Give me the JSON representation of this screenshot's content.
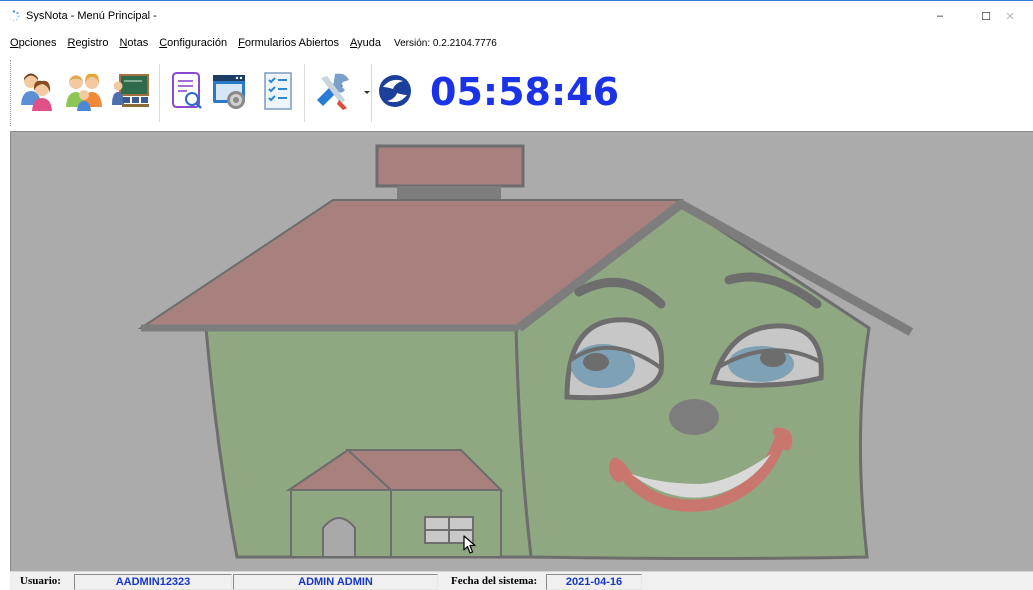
{
  "window": {
    "title": "SysNota - Menú Principal -",
    "minimize_glyph": "–",
    "maximize_glyph": "☐",
    "close_glyph": "✕"
  },
  "menu": {
    "items": [
      {
        "accel": "O",
        "rest": "pciones"
      },
      {
        "accel": "R",
        "rest": "egistro"
      },
      {
        "accel": "N",
        "rest": "otas"
      },
      {
        "accel": "C",
        "rest": "onfiguración"
      },
      {
        "accel": "F",
        "rest": "ormularios Abiertos"
      },
      {
        "accel": "A",
        "rest": "yuda"
      }
    ],
    "version": "Versión: 0.2.2104.7776"
  },
  "toolbar": {
    "icons": [
      "student-icon",
      "parents-icon",
      "teacher-icon",
      "report-scroll-icon",
      "settings-window-icon",
      "checklist-icon",
      "tools-icon",
      "app-logo-icon"
    ],
    "clock": "05:58:46",
    "clock_color": "#1a33e6"
  },
  "statusbar": {
    "user_label": "Usuario:",
    "user_code": "AADMIN12323",
    "user_name": "ADMIN ADMIN",
    "date_label": "Fecha del sistema:",
    "date_value": "2021-04-16",
    "value_color": "#1536c8"
  },
  "colors": {
    "workspace_bg": "#ababab",
    "roof": "#a8807e",
    "wall": "#8fa882",
    "chimney": "#7d7d7d",
    "eye": "#7fa1b5",
    "smile": "#c9766f"
  }
}
